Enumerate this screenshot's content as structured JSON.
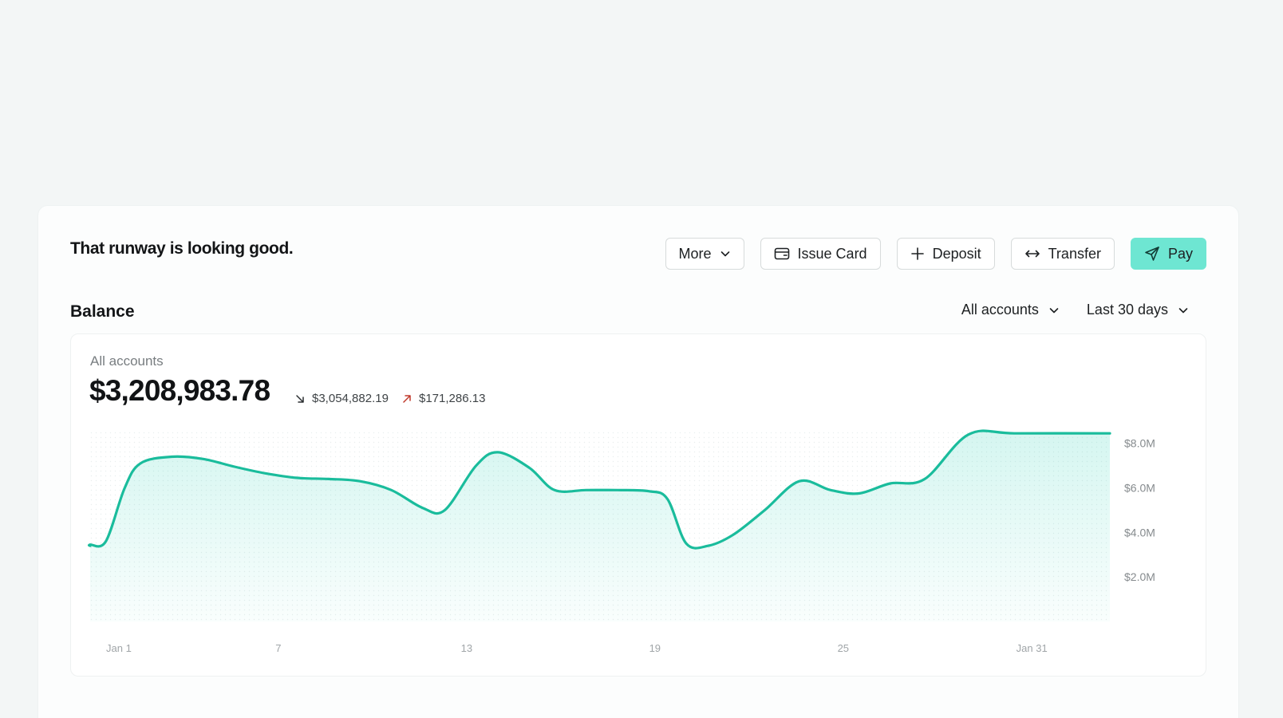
{
  "header": {
    "headline": "That runway is looking good."
  },
  "actions": {
    "more_label": "More",
    "issue_card_label": "Issue Card",
    "deposit_label": "Deposit",
    "transfer_label": "Transfer",
    "pay_label": "Pay"
  },
  "balance_section": {
    "title": "Balance",
    "account_filter": "All accounts",
    "range_filter": "Last 30 days"
  },
  "summary": {
    "accounts_label": "All accounts",
    "total_balance": "$3,208,983.78",
    "money_out": "$3,054,882.19",
    "money_in": "$171,286.13"
  },
  "colors": {
    "accent": "#6ee6d2",
    "line": "#1abc9c",
    "money_in_arrow": "#c0392b",
    "page_bg": "#f3f6f6"
  },
  "chart_data": {
    "type": "area",
    "x_ticks": [
      "Jan 1",
      "7",
      "13",
      "19",
      "25",
      "Jan 31"
    ],
    "y_ticks": [
      "$2.0M",
      "$4.0M",
      "$6.0M",
      "$8.0M"
    ],
    "y_tick_values": [
      2,
      4,
      6,
      8
    ],
    "ylim": [
      0,
      8.6
    ],
    "y_unit": "M",
    "x_range": [
      0,
      32.5
    ],
    "x_tick_positions": [
      0,
      6,
      12,
      18,
      24,
      30
    ],
    "points": [
      [
        -1.0,
        3.4
      ],
      [
        0.0,
        3.45
      ],
      [
        0.5,
        3.6
      ],
      [
        1.1,
        6.0
      ],
      [
        1.6,
        7.1
      ],
      [
        2.6,
        7.4
      ],
      [
        3.6,
        7.3
      ],
      [
        4.6,
        6.95
      ],
      [
        5.6,
        6.65
      ],
      [
        6.6,
        6.45
      ],
      [
        7.6,
        6.4
      ],
      [
        8.6,
        6.3
      ],
      [
        9.6,
        5.9
      ],
      [
        10.6,
        5.1
      ],
      [
        11.3,
        5.0
      ],
      [
        12.3,
        7.0
      ],
      [
        13.0,
        7.6
      ],
      [
        14.0,
        6.9
      ],
      [
        14.8,
        5.9
      ],
      [
        15.8,
        5.9
      ],
      [
        16.8,
        5.9
      ],
      [
        17.8,
        5.85
      ],
      [
        18.4,
        5.5
      ],
      [
        19.0,
        3.5
      ],
      [
        19.7,
        3.4
      ],
      [
        20.5,
        3.9
      ],
      [
        21.5,
        5.0
      ],
      [
        22.6,
        6.3
      ],
      [
        23.6,
        5.9
      ],
      [
        24.5,
        5.75
      ],
      [
        25.5,
        6.2
      ],
      [
        26.6,
        6.4
      ],
      [
        28.0,
        8.4
      ],
      [
        29.5,
        8.45
      ],
      [
        32.5,
        8.45
      ]
    ]
  }
}
